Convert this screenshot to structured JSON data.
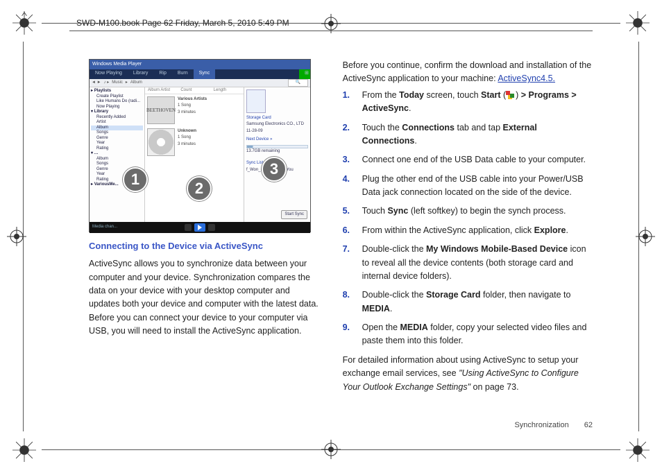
{
  "header": "SWD-M100.book  Page 62  Friday, March 5, 2010  5:49 PM",
  "screenshot": {
    "window_title": "Windows Media Player",
    "tabs": [
      "Now Playing",
      "Library",
      "Rip",
      "Burn",
      "Sync"
    ],
    "active_tab": "Sync",
    "toolbar": {
      "music": "Music",
      "album": "Album",
      "search_placeholder": "Search"
    },
    "sidebar": {
      "items": [
        "Playlists",
        "Create Playlist",
        "Like Humans Do (radi...",
        "Now Playing",
        "Library",
        "Recently Added",
        "Artist",
        "Album",
        "Songs",
        "Genre",
        "Year",
        "Rating",
        "Album",
        "Songs",
        "Genre",
        "Year",
        "Rating",
        "VariousMe..."
      ],
      "selected": "Album"
    },
    "list_headers": [
      "Album Artist",
      "Count",
      "Length"
    ],
    "albums": [
      {
        "art_label": "BEETHOVEN",
        "title": "Various Artists",
        "detail1": "1 Song",
        "detail2": "3 minutes"
      },
      {
        "art_label": "",
        "title": "Unknown",
        "detail1": "1 Song",
        "detail2": "3 minutes"
      }
    ],
    "sync_pane": {
      "title": "Storage Card",
      "subtitle": "Samsung Electronics CO., LTD",
      "date": "11-28-09",
      "next_device": "Next Device »",
      "remaining": "13.7GB remaining",
      "sync_list_title": "Sync List",
      "track": "f_Won_ru_Bep_Like_You",
      "button": "Start Sync"
    },
    "status_bar": "Media chan...",
    "callouts": [
      "1",
      "2",
      "3"
    ]
  },
  "left": {
    "heading": "Connecting to the Device via ActiveSync",
    "para": "ActiveSync allows you to synchronize data between your computer and your device. Synchronization compares the data on your device with your desktop computer and updates both your device and computer with the latest data. Before you can connect your device to your computer via USB, you will need to install the ActiveSync application."
  },
  "right": {
    "intro_a": "Before you continue, confirm the download and installation of the ActiveSync application to your machine: ",
    "intro_link": "ActiveSync4.5.",
    "steps": [
      {
        "n": "1.",
        "pre": "From the ",
        "b1": "Today",
        "mid1": " screen, touch ",
        "b2": "Start",
        "mid2": " (",
        "post_icon": ") ",
        "b3": "> Programs > ActiveSync",
        "tail": "."
      },
      {
        "n": "2.",
        "pre": "Touch the ",
        "b1": "Connections",
        "mid1": " tab and tap ",
        "b2": "External Connections",
        "tail": "."
      },
      {
        "n": "3.",
        "pre": "Connect one end of the USB Data cable to your computer.",
        "tail": ""
      },
      {
        "n": "4.",
        "pre": "Plug the other end of the USB cable into your Power/USB Data jack connection located on the side of the device.",
        "tail": ""
      },
      {
        "n": "5.",
        "pre": "Touch ",
        "b1": "Sync",
        "mid1": " (left softkey) to begin the synch process.",
        "tail": ""
      },
      {
        "n": "6.",
        "pre": "From within the ActiveSync application, click ",
        "b1": "Explore",
        "tail": "."
      },
      {
        "n": "7.",
        "pre": "Double-click the ",
        "b1": "My Windows Mobile-Based Device",
        "mid1": " icon to reveal all the device contents (both storage card and internal device folders).",
        "tail": ""
      },
      {
        "n": "8.",
        "pre": "Double-click the ",
        "b1": "Storage Card",
        "mid1": " folder, then navigate to ",
        "b2": "MEDIA",
        "tail": "."
      },
      {
        "n": "9.",
        "pre": "Open the ",
        "b1": "MEDIA",
        "mid1": " folder, copy your selected video files and paste them into this folder.",
        "tail": ""
      }
    ],
    "outro_a": "For detailed information about using ActiveSync to setup your exchange email services, see ",
    "outro_i": "\"Using ActiveSync to Configure Your Outlook Exchange Settings\"",
    "outro_b": " on page 73."
  },
  "footer": {
    "section": "Synchronization",
    "page": "62"
  }
}
